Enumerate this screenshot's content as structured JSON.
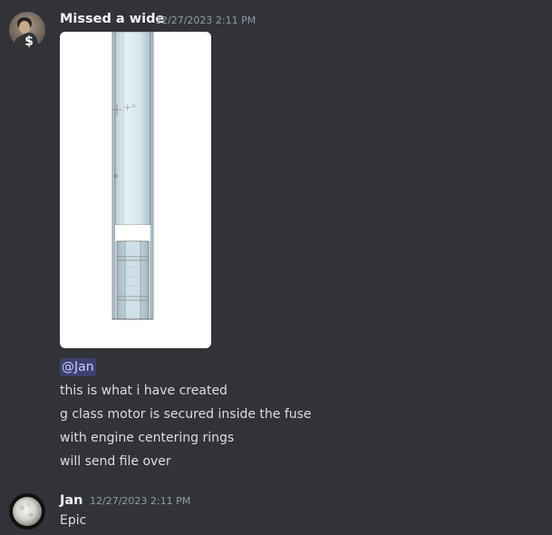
{
  "messages": [
    {
      "username": "Missed a wide",
      "timestamp": "12/27/2023 2:11 PM",
      "avatar_icon": "user-avatar-dollar-icon",
      "mention": "@Jan",
      "lines": [
        "this is what i have created",
        "g class motor is secured inside the fuse",
        "with engine centering rings",
        "will send file over"
      ]
    },
    {
      "username": "Jan",
      "timestamp": "12/27/2023 2:11 PM",
      "avatar_icon": "user-avatar-moon-icon",
      "lines": [
        "Epic"
      ]
    }
  ],
  "colors": {
    "background": "#313338",
    "username": "#f2f3f5",
    "timestamp": "#949ba4",
    "text": "#dbdee1",
    "mention_bg": "#3c4270",
    "mention_text": "#c9cdfb"
  }
}
